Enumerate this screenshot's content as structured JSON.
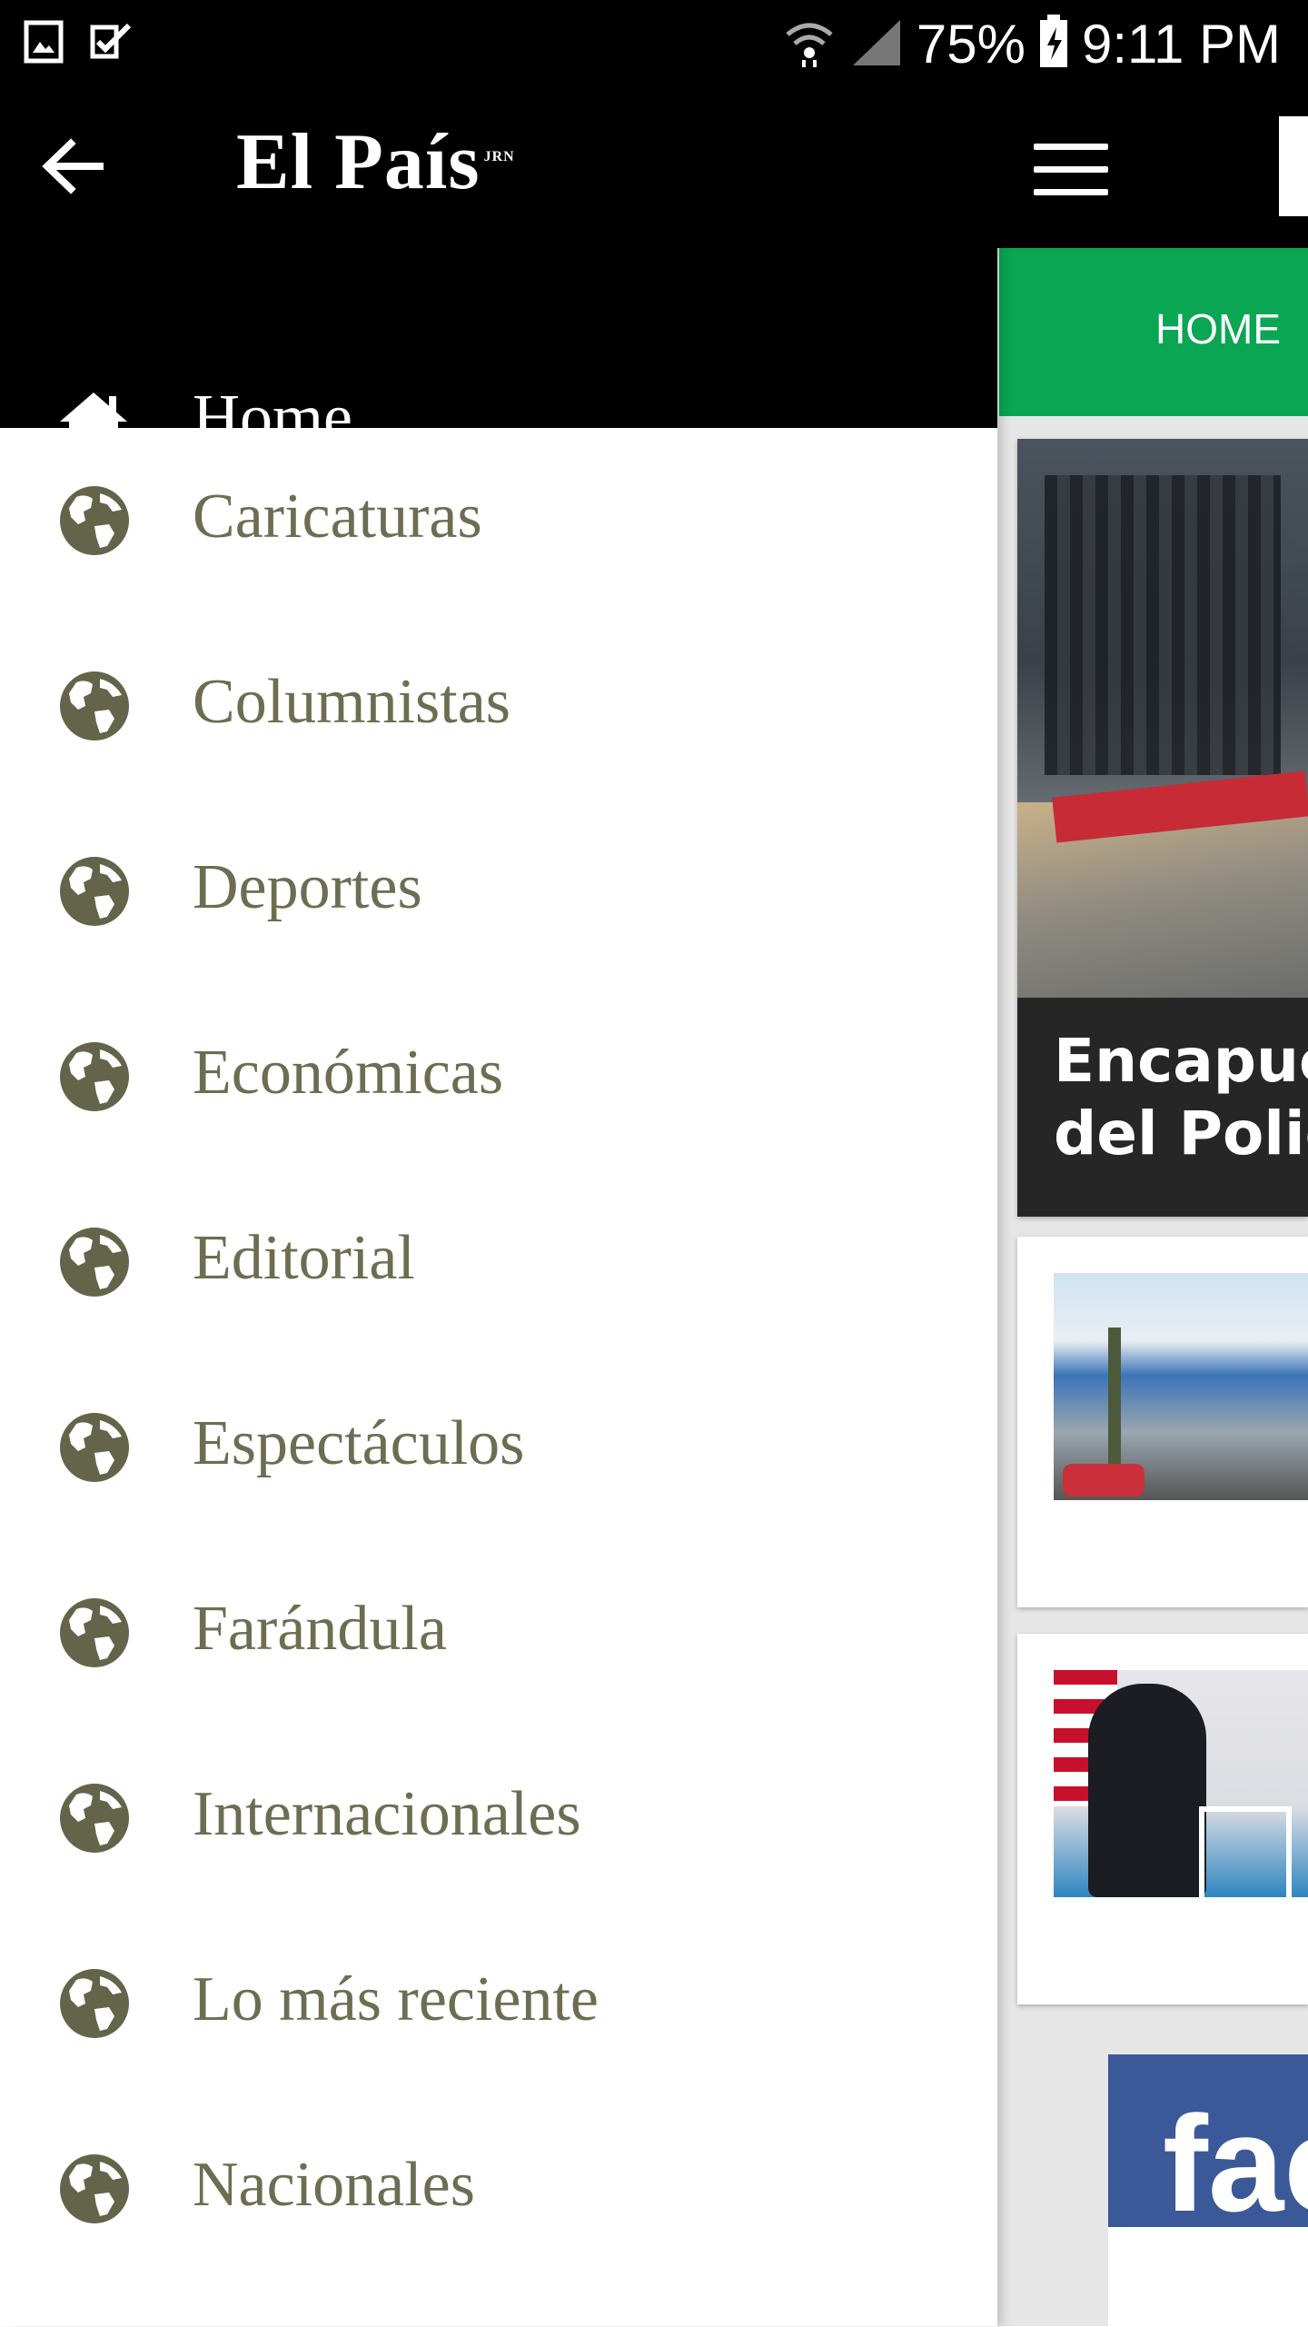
{
  "status_bar": {
    "battery_percent": "75%",
    "time": "9:11 PM",
    "icons": [
      "image-icon",
      "task-check-icon",
      "wifi-icon",
      "signal-icon",
      "battery-charging-icon"
    ]
  },
  "drawer": {
    "brand": "El País",
    "brand_mark": "JRN",
    "back_icon": "arrow-left-icon",
    "home_label": "Home",
    "home_icon": "home-icon",
    "items": [
      {
        "label": "Caricaturas",
        "icon": "globe-icon"
      },
      {
        "label": "Columnistas",
        "icon": "globe-icon"
      },
      {
        "label": "Deportes",
        "icon": "globe-icon"
      },
      {
        "label": "Económicas",
        "icon": "globe-icon"
      },
      {
        "label": "Editorial",
        "icon": "globe-icon"
      },
      {
        "label": "Espectáculos",
        "icon": "globe-icon"
      },
      {
        "label": "Farándula",
        "icon": "globe-icon"
      },
      {
        "label": "Internacionales",
        "icon": "globe-icon"
      },
      {
        "label": "Lo más reciente",
        "icon": "globe-icon"
      },
      {
        "label": "Nacionales",
        "icon": "globe-icon"
      }
    ]
  },
  "background_page": {
    "tab_label": "HOME",
    "hero_caption_line1": "Encapuc",
    "hero_caption_line2": "del Polic",
    "facebook_text": "fac",
    "colors": {
      "tab_bar": "#0aa653",
      "facebook": "#3b5998",
      "menu_text": "#6d6d52"
    }
  }
}
